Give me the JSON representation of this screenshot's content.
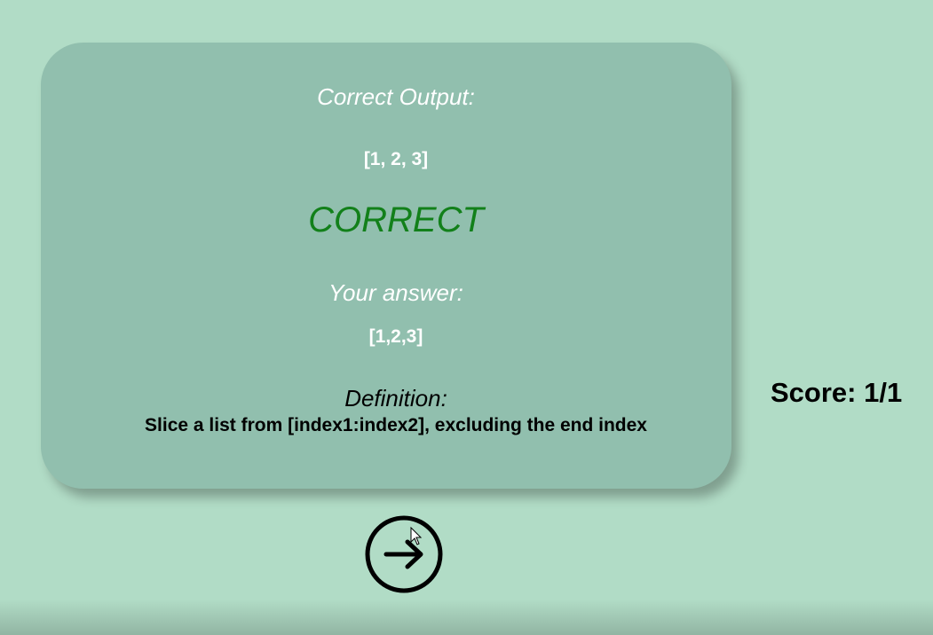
{
  "card": {
    "output_label": "Correct Output:",
    "output_value": "[1, 2, 3]",
    "result": "CORRECT",
    "answer_label": "Your answer:",
    "answer_value": "[1,2,3]",
    "definition_label": "Definition:",
    "definition_text": "Slice a list from [index1:index2], excluding the end index"
  },
  "score": "Score: 1/1",
  "next_button": {
    "icon": "arrow-right-circle-icon"
  },
  "colors": {
    "background": "#b1dcc6",
    "card": "#91bfae",
    "correct": "#12801a"
  }
}
